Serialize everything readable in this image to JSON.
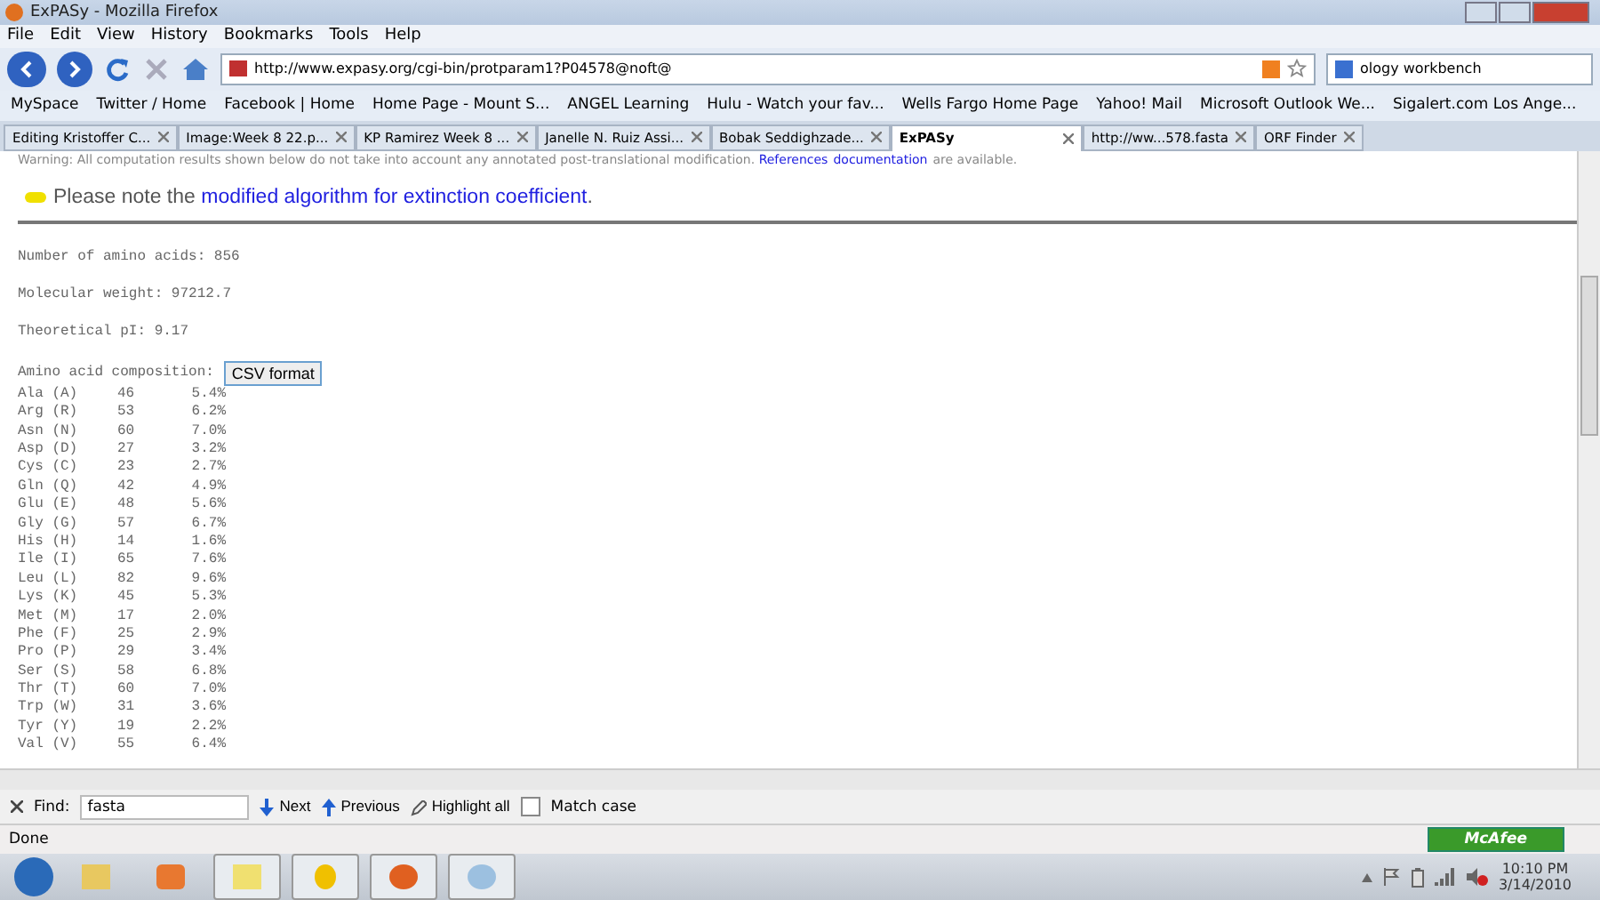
{
  "window": {
    "title": "ExPASy - Mozilla Firefox"
  },
  "menu": [
    "File",
    "Edit",
    "View",
    "History",
    "Bookmarks",
    "Tools",
    "Help"
  ],
  "address": {
    "value": "http://www.expasy.org/cgi-bin/protparam1?P04578@noft@"
  },
  "search": {
    "value": "ology workbench"
  },
  "bookmarks": [
    "MySpace",
    "Twitter / Home",
    "Facebook | Home",
    "Home Page - Mount S...",
    "ANGEL Learning",
    "Hulu - Watch your fav...",
    "Wells Fargo Home Page",
    "Yahoo! Mail",
    "Microsoft Outlook We...",
    "Sigalert.com Los Ange..."
  ],
  "tabs": [
    {
      "label": "Editing Kristoffer C...",
      "selected": false
    },
    {
      "label": "Image:Week 8 22.p...",
      "selected": false
    },
    {
      "label": "KP Ramirez Week 8 ...",
      "selected": false
    },
    {
      "label": "Janelle N. Ruiz Assi...",
      "selected": false
    },
    {
      "label": "Bobak Seddighzade...",
      "selected": false
    },
    {
      "label": "ExPASy",
      "selected": true
    },
    {
      "label": "http://ww...578.fasta",
      "selected": false
    },
    {
      "label": "ORF Finder",
      "selected": false
    }
  ],
  "page": {
    "warning": "Warning: All computation results shown below do not take into account any annotated post-translational modification.",
    "warning_links": [
      "References",
      "documentation"
    ],
    "warning_tail": "are available.",
    "note_prefix": "Please note the",
    "note_link": "modified algorithm for extinction coefficient",
    "note_suffix": ".",
    "stats": [
      "Number of amino acids: 856",
      "Molecular weight: 97212.7",
      "Theoretical pI: 9.17"
    ],
    "composition_label": "Amino acid composition:",
    "csv_button": "CSV format",
    "composition": [
      [
        "Ala (A)",
        "46",
        "5.4%"
      ],
      [
        "Arg (R)",
        "53",
        "6.2%"
      ],
      [
        "Asn (N)",
        "60",
        "7.0%"
      ],
      [
        "Asp (D)",
        "27",
        "3.2%"
      ],
      [
        "Cys (C)",
        "23",
        "2.7%"
      ],
      [
        "Gln (Q)",
        "42",
        "4.9%"
      ],
      [
        "Glu (E)",
        "48",
        "5.6%"
      ],
      [
        "Gly (G)",
        "57",
        "6.7%"
      ],
      [
        "His (H)",
        "14",
        "1.6%"
      ],
      [
        "Ile (I)",
        "65",
        "7.6%"
      ],
      [
        "Leu (L)",
        "82",
        "9.6%"
      ],
      [
        "Lys (K)",
        "45",
        "5.3%"
      ],
      [
        "Met (M)",
        "17",
        "2.0%"
      ],
      [
        "Phe (F)",
        "25",
        "2.9%"
      ],
      [
        "Pro (P)",
        "29",
        "3.4%"
      ],
      [
        "Ser (S)",
        "58",
        "6.8%"
      ],
      [
        "Thr (T)",
        "60",
        "7.0%"
      ],
      [
        "Trp (W)",
        "31",
        "3.6%"
      ],
      [
        "Tyr (Y)",
        "19",
        "2.2%"
      ],
      [
        "Val (V)",
        "55",
        "6.4%"
      ]
    ]
  },
  "find_bar": {
    "label": "Find:",
    "value": "fasta",
    "next": "Next",
    "previous": "Previous",
    "highlight": "Highlight all",
    "match_case": "Match case",
    "match_case_checked": false
  },
  "status_bar": {
    "text": "Done",
    "addon": "McAfee"
  },
  "clock": {
    "time": "10:10 PM",
    "date": "3/14/2010"
  }
}
